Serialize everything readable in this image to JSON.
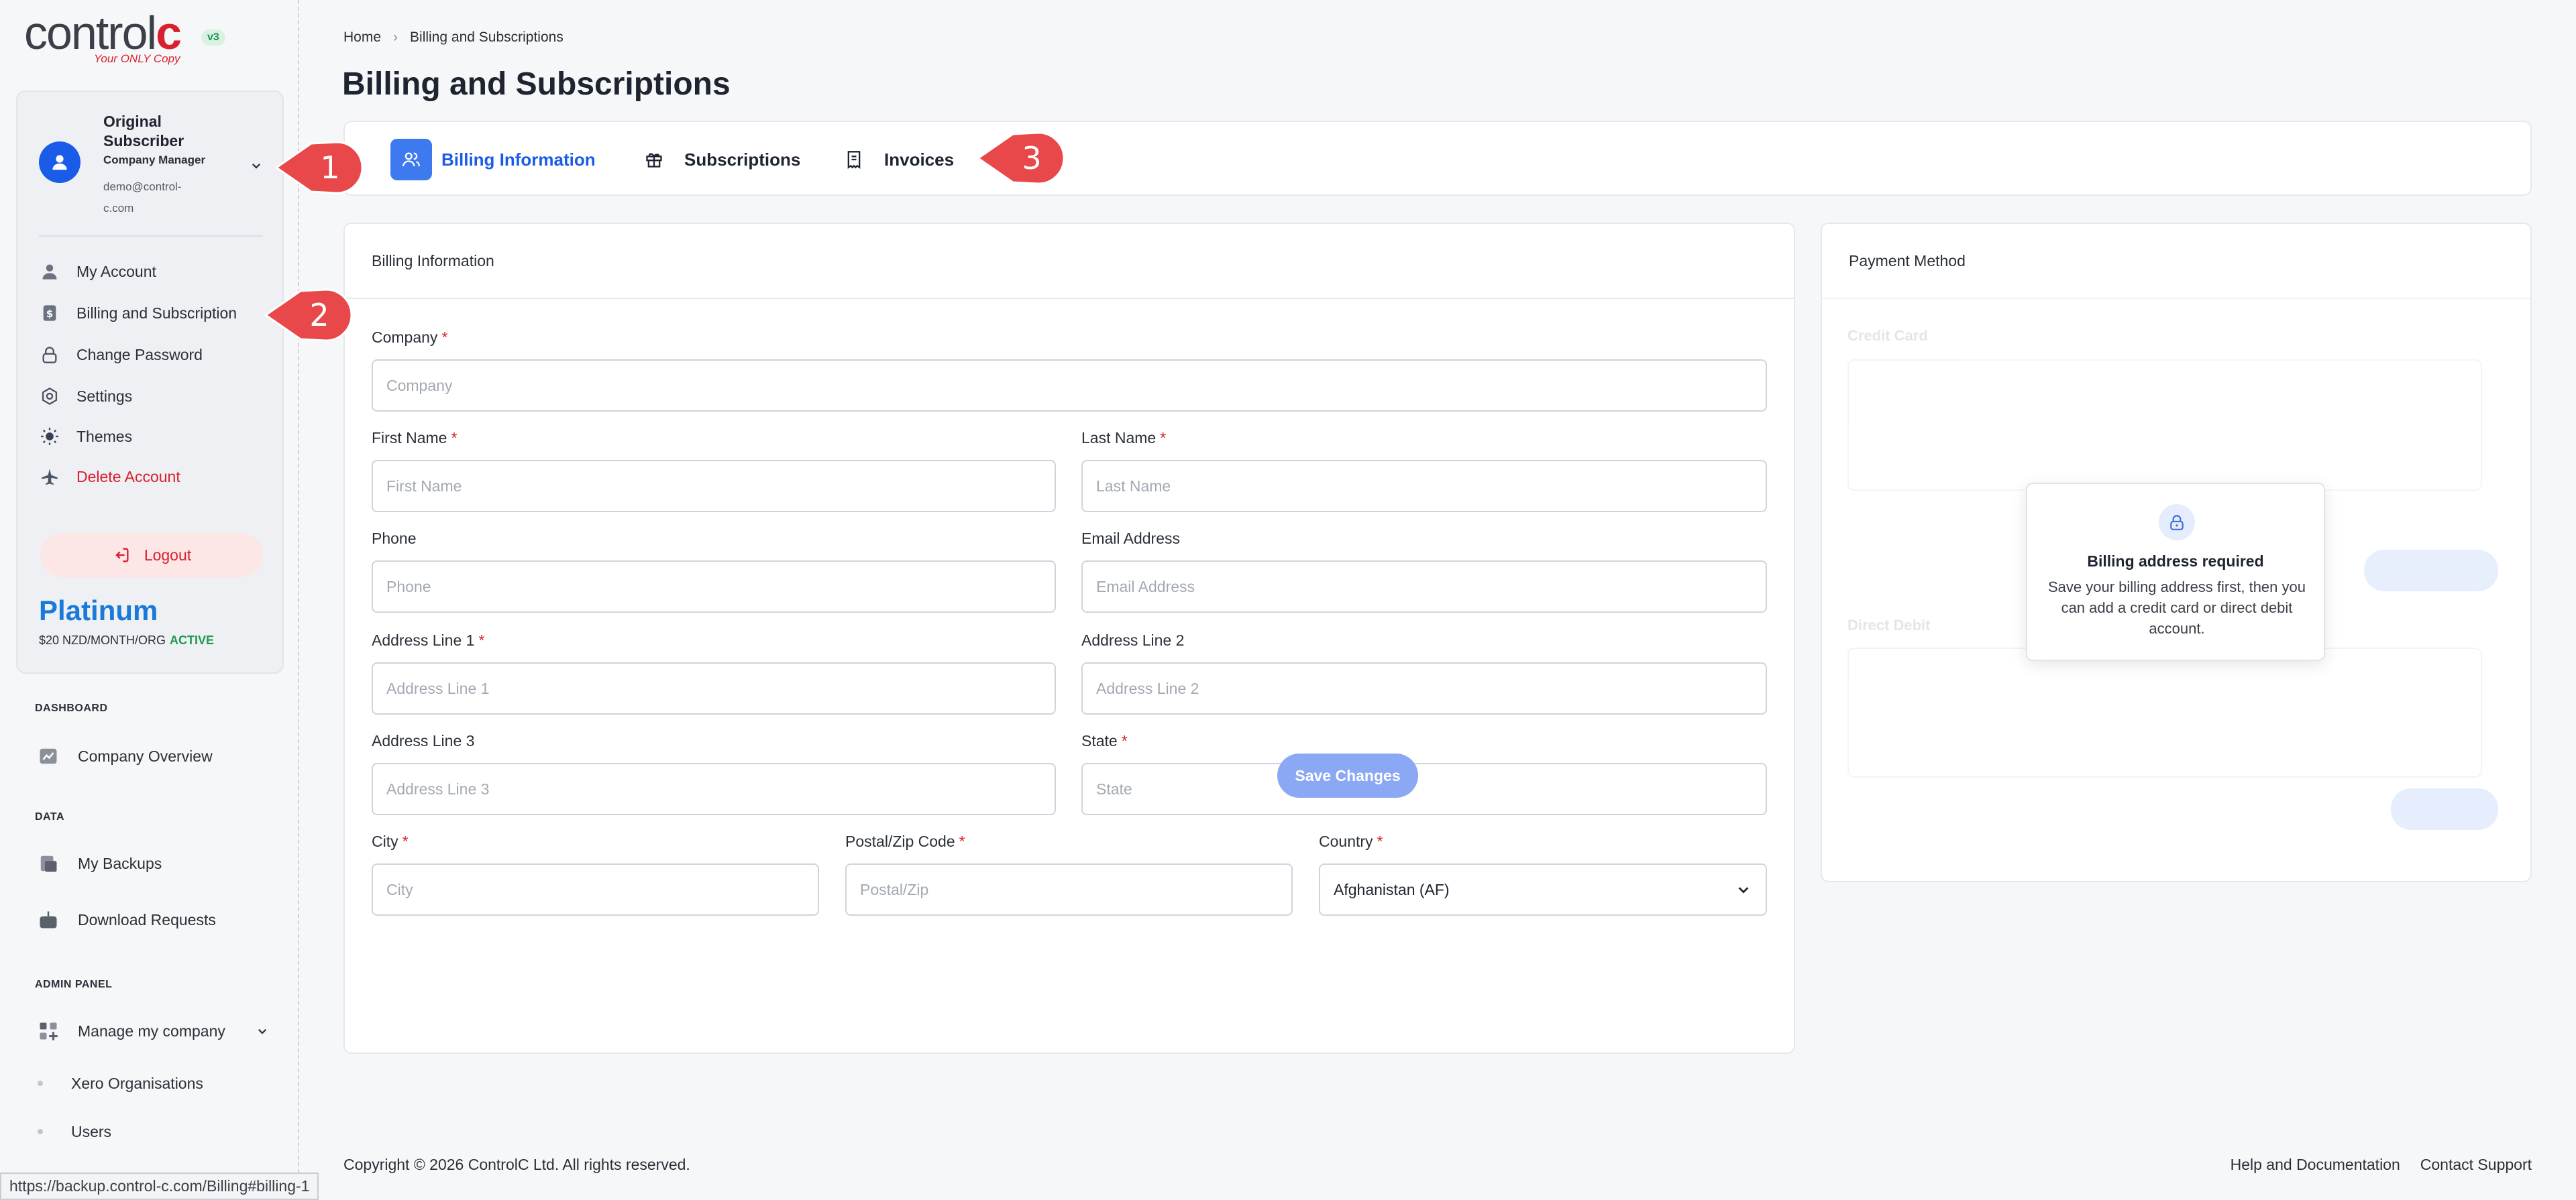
{
  "brand": {
    "logo_main": "control",
    "logo_accent": "c",
    "tagline": "Your ONLY Copy",
    "version": "v3"
  },
  "profile": {
    "name": "Original Subscriber",
    "role": "Company Manager",
    "email": "demo@control-c.com"
  },
  "account_menu": [
    {
      "label": "My Account",
      "icon": "user-icon"
    },
    {
      "label": "Billing and Subscription",
      "icon": "dollar-icon"
    },
    {
      "label": "Change Password",
      "icon": "lock-icon"
    },
    {
      "label": "Settings",
      "icon": "gear-icon"
    },
    {
      "label": "Themes",
      "icon": "sun-icon"
    },
    {
      "label": "Delete Account",
      "icon": "plane-icon"
    }
  ],
  "logout_label": "Logout",
  "plan": {
    "name": "Platinum",
    "price": "$20 NZD/MONTH/ORG",
    "status": "ACTIVE"
  },
  "nav": {
    "dashboard_label": "DASHBOARD",
    "company_overview": "Company Overview",
    "data_label": "DATA",
    "my_backups": "My Backups",
    "download_requests": "Download Requests",
    "admin_label": "ADMIN PANEL",
    "manage_company": "Manage my company",
    "xero_orgs": "Xero Organisations",
    "users": "Users"
  },
  "status_url": "https://backup.control-c.com/Billing#billing-1",
  "breadcrumb": {
    "home": "Home",
    "current": "Billing and Subscriptions"
  },
  "page_title": "Billing and Subscriptions",
  "tabs": [
    {
      "label": "Billing Information",
      "active": true
    },
    {
      "label": "Subscriptions",
      "active": false
    },
    {
      "label": "Invoices",
      "active": false
    }
  ],
  "billing_form": {
    "title": "Billing Information",
    "company": {
      "label": "Company",
      "placeholder": "Company",
      "value": ""
    },
    "first_name": {
      "label": "First Name",
      "placeholder": "First Name",
      "value": ""
    },
    "last_name": {
      "label": "Last Name",
      "placeholder": "Last Name",
      "value": ""
    },
    "phone": {
      "label": "Phone",
      "placeholder": "Phone",
      "value": ""
    },
    "email": {
      "label": "Email Address",
      "placeholder": "Email Address",
      "value": ""
    },
    "address1": {
      "label": "Address Line 1",
      "placeholder": "Address Line 1",
      "value": ""
    },
    "address2": {
      "label": "Address Line 2",
      "placeholder": "Address Line 2",
      "value": ""
    },
    "address3": {
      "label": "Address Line 3",
      "placeholder": "Address Line 3",
      "value": ""
    },
    "state": {
      "label": "State",
      "placeholder": "State",
      "value": ""
    },
    "city": {
      "label": "City",
      "placeholder": "City",
      "value": ""
    },
    "postal": {
      "label": "Postal/Zip Code",
      "placeholder": "Postal/Zip",
      "value": ""
    },
    "country": {
      "label": "Country",
      "value": "Afghanistan (AF)"
    },
    "required_mark": "*",
    "save_label": "Save Changes"
  },
  "payment": {
    "title": "Payment Method",
    "credit_card_label": "Credit Card",
    "direct_debit_label": "Direct Debit",
    "modal_title": "Billing address required",
    "modal_text": "Save your billing address first, then you can add a credit card or direct debit account."
  },
  "footer": {
    "copyright": "Copyright © 2026 ControlC Ltd. All rights reserved.",
    "help": "Help and Documentation",
    "support": "Contact Support"
  },
  "callouts": [
    "1",
    "2",
    "3"
  ],
  "colors": {
    "accent": "#1a5ce8",
    "brand_red": "#d8202e",
    "callout": "#e8484a",
    "active_green": "#1e9a55"
  }
}
